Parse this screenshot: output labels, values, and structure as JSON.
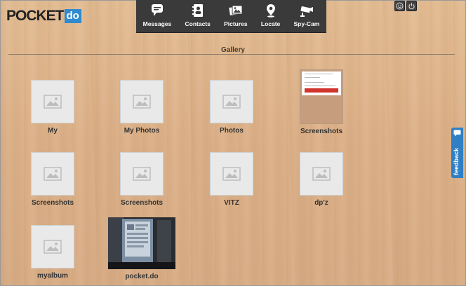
{
  "brand": {
    "name": "POCKET",
    "suffix": "do",
    "accent": "#2f8bd0"
  },
  "nav": {
    "items": [
      {
        "label": "Messages",
        "icon": "sms-icon"
      },
      {
        "label": "Contacts",
        "icon": "contacts-icon"
      },
      {
        "label": "Pictures",
        "icon": "pictures-icon"
      },
      {
        "label": "Locate",
        "icon": "location-pin-icon"
      },
      {
        "label": "Spy-Cam",
        "icon": "camera-icon"
      }
    ]
  },
  "corner": {
    "icons": [
      "smiley-icon",
      "power-icon"
    ]
  },
  "gallery": {
    "title": "Gallery",
    "albums": [
      {
        "label": "My"
      },
      {
        "label": "My Photos"
      },
      {
        "label": "Photos"
      },
      {
        "label": "Screenshots"
      },
      {
        "label": "Screenshots"
      },
      {
        "label": "Screenshots"
      },
      {
        "label": "VITZ"
      },
      {
        "label": "dp'z"
      },
      {
        "label": "myalbum"
      },
      {
        "label": "pocket.do"
      }
    ]
  },
  "feedback": {
    "label": "feedback",
    "color": "#2f7fc4"
  }
}
